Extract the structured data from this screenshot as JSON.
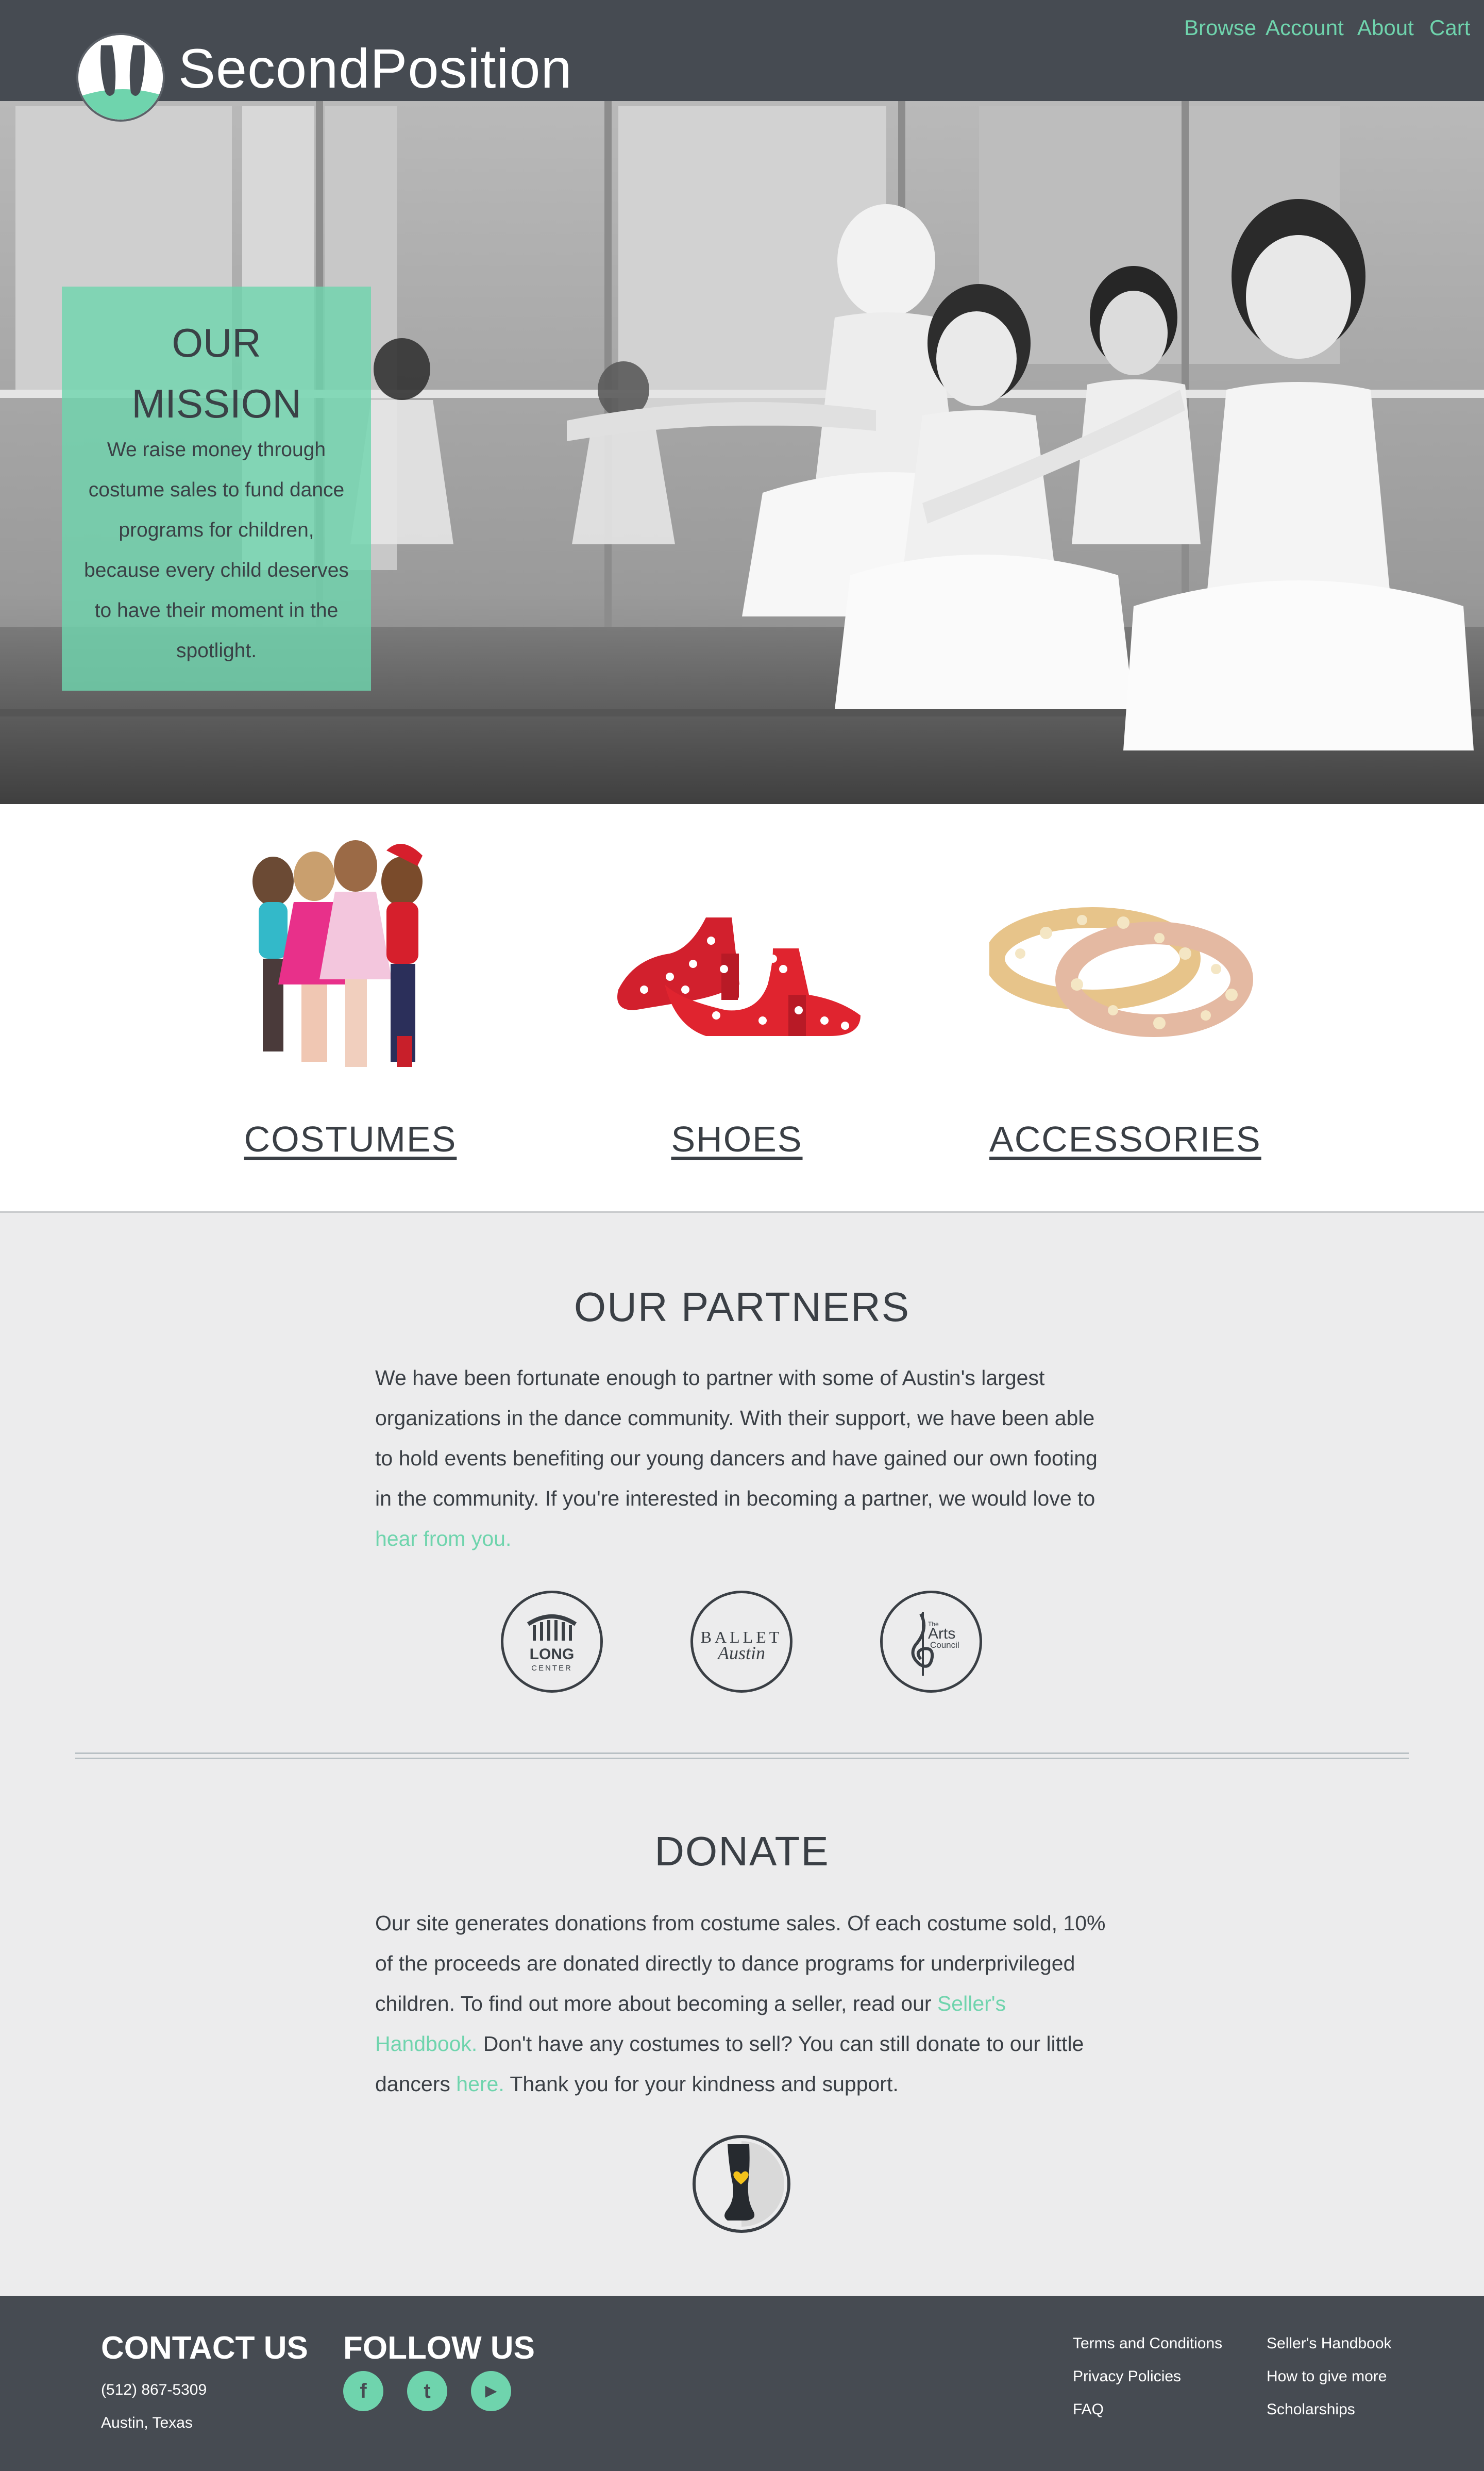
{
  "header": {
    "logo_text": "SecondPosition",
    "nav": [
      "Browse",
      "Account",
      "About",
      "Cart"
    ]
  },
  "hero": {
    "mission_title_line1": "OUR",
    "mission_title_line2": "MISSION",
    "mission_text": "We raise money through costume sales to fund dance programs for children, because every child deserves to have their moment in the spotlight."
  },
  "categories": [
    {
      "label": "COSTUMES"
    },
    {
      "label": "SHOES"
    },
    {
      "label": "ACCESSORIES"
    }
  ],
  "partners": {
    "title": "OUR PARTNERS",
    "text": "We have been fortunate enough to partner with some of Austin's largest organizations in the dance community. With their support, we have been able to hold events benefiting our young dancers and have gained our own footing in the community. If you're interested in becoming a partner, we would love to ",
    "link": "hear from you.",
    "logos": [
      {
        "name": "long-center",
        "line1": "LONG",
        "line2": "CENTER"
      },
      {
        "name": "ballet-austin",
        "line1": "BALLET",
        "line2": "Austin"
      },
      {
        "name": "arts-council",
        "line1": "Arts",
        "line2": "Council",
        "prefix": "The"
      }
    ]
  },
  "donate": {
    "title": "DONATE",
    "text_1": "Our site generates donations from costume sales. Of each costume sold, 10% of the proceeds are donated directly to dance programs for underprivileged children. To find out more about becoming a seller, read our ",
    "link_1": "Seller's Handbook.",
    "text_2": " Don't have any costumes to sell? You can still donate to our little dancers ",
    "link_2": "here.",
    "text_3": " Thank you for your kindness and support."
  },
  "footer": {
    "contact_heading": "CONTACT US",
    "phone": "(512) 867-5309",
    "location": "Austin, Texas",
    "follow_heading": "FOLLOW US",
    "social": [
      {
        "name": "facebook",
        "glyph": "f"
      },
      {
        "name": "twitter",
        "glyph": "t"
      },
      {
        "name": "youtube",
        "glyph": "▶"
      }
    ],
    "links_col1": [
      "Terms and Conditions",
      "Privacy Policies",
      "FAQ"
    ],
    "links_col2": [
      "Seller's Handbook",
      "How to give more",
      "Scholarships"
    ]
  },
  "colors": {
    "header_bg": "#464b52",
    "accent": "#6fd4ad",
    "page_bg": "#ececed",
    "text": "#3a3f45"
  }
}
